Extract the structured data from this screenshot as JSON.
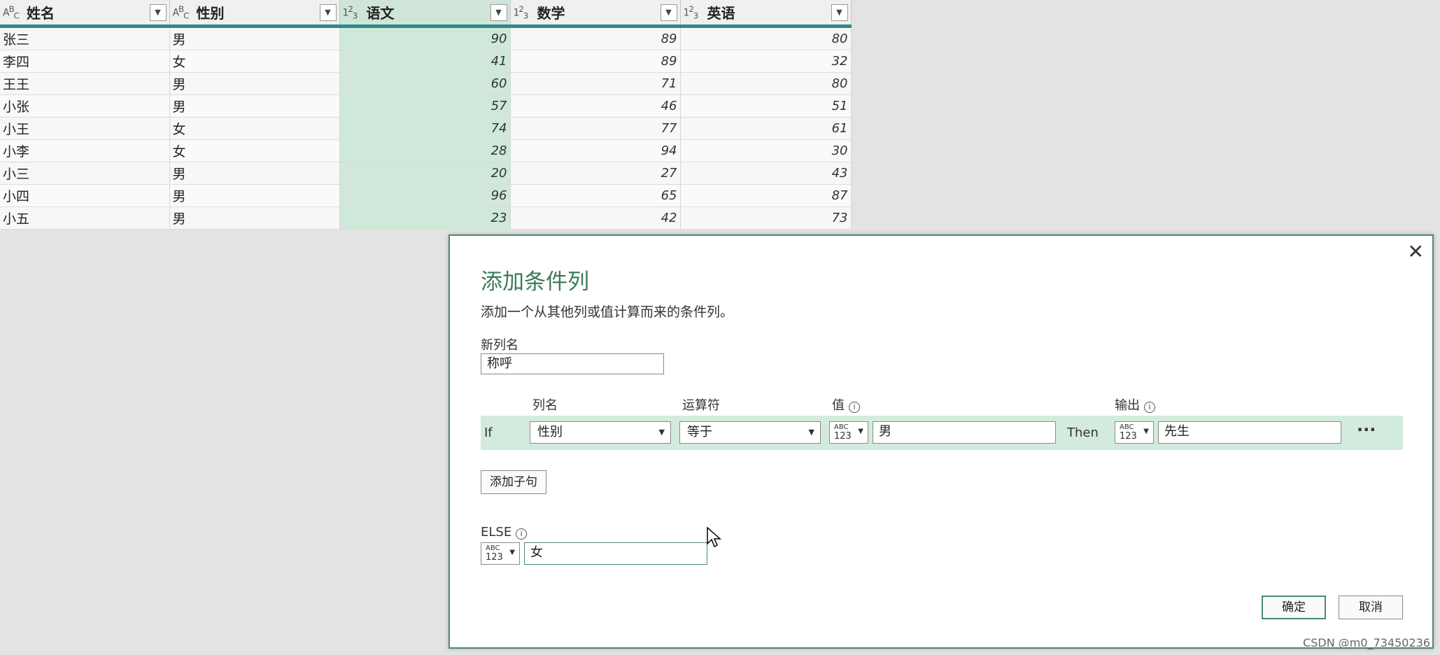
{
  "grid": {
    "columns": [
      {
        "type_icon": "ABC",
        "label": "姓名"
      },
      {
        "type_icon": "ABC",
        "label": "性别"
      },
      {
        "type_icon": "123",
        "label": "语文"
      },
      {
        "type_icon": "123",
        "label": "数学"
      },
      {
        "type_icon": "123",
        "label": "英语"
      }
    ],
    "rows": [
      [
        "张三",
        "男",
        "90",
        "89",
        "80"
      ],
      [
        "李四",
        "女",
        "41",
        "89",
        "32"
      ],
      [
        "王王",
        "男",
        "60",
        "71",
        "80"
      ],
      [
        "小张",
        "男",
        "57",
        "46",
        "51"
      ],
      [
        "小王",
        "女",
        "74",
        "77",
        "61"
      ],
      [
        "小李",
        "女",
        "28",
        "94",
        "30"
      ],
      [
        "小三",
        "男",
        "20",
        "27",
        "43"
      ],
      [
        "小四",
        "男",
        "96",
        "65",
        "87"
      ],
      [
        "小五",
        "男",
        "23",
        "42",
        "73"
      ]
    ],
    "selected_column": "语文"
  },
  "dialog": {
    "title": "添加条件列",
    "description": "添加一个从其他列或值计算而来的条件列。",
    "new_column_label": "新列名",
    "new_column_value": "称呼",
    "headers": {
      "column_name": "列名",
      "operator": "运算符",
      "value": "值",
      "output": "输出"
    },
    "rule": {
      "if_label": "If",
      "column": "性别",
      "operator": "等于",
      "value_type_abc": "ABC",
      "value_type_123": "123",
      "value": "男",
      "then_label": "Then",
      "output_type_abc": "ABC",
      "output_type_123": "123",
      "output": "先生",
      "more": "···"
    },
    "add_clause": "添加子句",
    "else_label": "ELSE",
    "else_type_abc": "ABC",
    "else_type_123": "123",
    "else_value": "女",
    "ok": "确定",
    "cancel": "取消",
    "close": "✕"
  },
  "watermark": "CSDN @m0_73450236"
}
